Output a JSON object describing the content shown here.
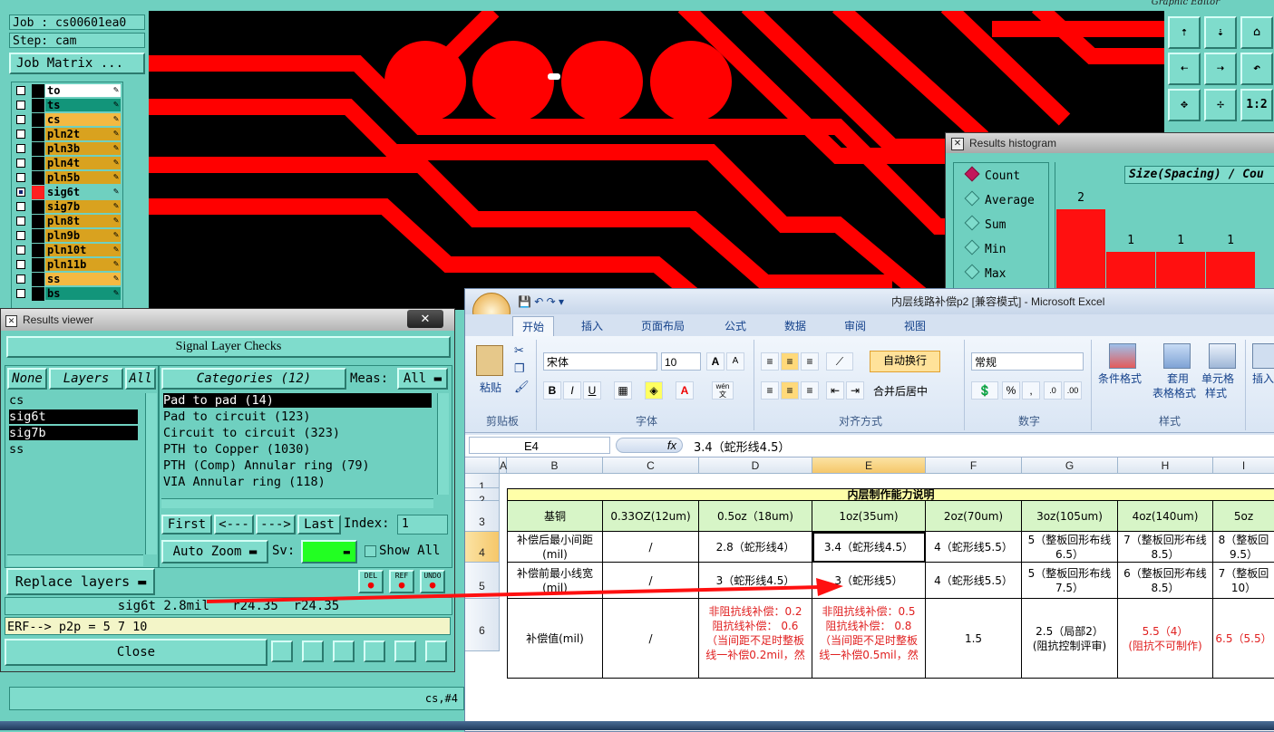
{
  "genesis": {
    "window_title": "Graphic Editor",
    "job_label": "Job : cs00601ea0",
    "step_label": "Step: cam",
    "job_matrix_button": "Job Matrix ...",
    "layers": [
      {
        "name": "to",
        "color": "#ffffff",
        "checked": false
      },
      {
        "name": "ts",
        "color": "#12957a",
        "checked": false
      },
      {
        "name": "cs",
        "color": "#f4b942",
        "checked": false
      },
      {
        "name": "pln2t",
        "color": "#d9a21f",
        "checked": false
      },
      {
        "name": "pln3b",
        "color": "#d9a21f",
        "checked": false
      },
      {
        "name": "pln4t",
        "color": "#d9a21f",
        "checked": false
      },
      {
        "name": "pln5b",
        "color": "#d9a21f",
        "checked": false
      },
      {
        "name": "sig6t",
        "color": "#6fd0c0",
        "checked": true
      },
      {
        "name": "sig7b",
        "color": "#d9a21f",
        "checked": false
      },
      {
        "name": "pln8t",
        "color": "#d9a21f",
        "checked": false
      },
      {
        "name": "pln9b",
        "color": "#d9a21f",
        "checked": false
      },
      {
        "name": "pln10t",
        "color": "#d9a21f",
        "checked": false
      },
      {
        "name": "pln11b",
        "color": "#d9a21f",
        "checked": false
      },
      {
        "name": "ss",
        "color": "#f4b942",
        "checked": false
      },
      {
        "name": "bs",
        "color": "#12957a",
        "checked": false
      }
    ],
    "toolbar": [
      "⇡",
      "⇣",
      "⌂",
      "⇠",
      "⇢",
      "↶",
      "✥",
      "✢",
      "1:2"
    ],
    "status_text": "cs,#4"
  },
  "histogram": {
    "title": "Results histogram",
    "options": [
      {
        "label": "Count",
        "selected": true
      },
      {
        "label": "Average",
        "selected": false
      },
      {
        "label": "Sum",
        "selected": false
      },
      {
        "label": "Min",
        "selected": false
      },
      {
        "label": "Max",
        "selected": false
      }
    ],
    "chart_header": "Size(Spacing) / Cou",
    "bars": [
      2,
      1,
      1,
      1
    ]
  },
  "results_viewer": {
    "title": "Results viewer",
    "close_x": "✕",
    "heading": "Signal Layer Checks",
    "none_btn": "None",
    "layers_btn": "Layers",
    "all_btn": "All",
    "layers": [
      "cs",
      "sig6t",
      "sig7b",
      "ss"
    ],
    "selected_layers": [
      "sig6t",
      "sig7b"
    ],
    "categories_btn": "Categories (12)",
    "meas_label": "Meas:",
    "meas_value": "All",
    "categories": [
      "Pad to pad (14)",
      "Pad to circuit (123)",
      "Circuit to circuit (323)",
      "PTH to Copper (1030)",
      "PTH (Comp) Annular ring (79)",
      "VIA Annular ring (118)"
    ],
    "nav": {
      "first": "First",
      "prev": "<---",
      "next": "--->",
      "last": "Last",
      "index_label": "Index:",
      "index_value": "1"
    },
    "auto_zoom": "Auto Zoom",
    "sv_label": "Sv:",
    "show_all": "Show All",
    "replace_layers": "Replace layers",
    "small_btns": [
      "DEL",
      "REF",
      "UNDO"
    ],
    "info_line": "sig6t 2.8mil   r24.35  r24.35",
    "erf_line": "ERF--> p2p = 5 7 10",
    "close_btn": "Close"
  },
  "excel": {
    "title": "内层线路补偿p2  [兼容模式] - Microsoft Excel",
    "tabs": [
      "开始",
      "插入",
      "页面布局",
      "公式",
      "数据",
      "审阅",
      "视图"
    ],
    "active_tab": "开始",
    "clipboard": {
      "paste": "粘贴",
      "group": "剪贴板"
    },
    "font": {
      "name": "宋体",
      "size": "10",
      "group": "字体",
      "bold": "B",
      "italic": "I",
      "underline": "U",
      "grow": "A",
      "shrink": "A",
      "wen": "wén",
      "wen2": "文"
    },
    "alignment": {
      "wrap": "自动换行",
      "merge": "合并后居中",
      "group": "对齐方式"
    },
    "number": {
      "format": "常规",
      "percent": "%",
      "comma": ",",
      "group": "数字"
    },
    "styles": {
      "cond": "条件格式",
      "table": "套用",
      "table2": "表格格式",
      "cell": "单元格",
      "cell2": "样式",
      "group": "样式"
    },
    "cells": {
      "insert": "插入"
    },
    "name_box": "E4",
    "fx": "fx",
    "formula": "3.4（蛇形线4.5）",
    "columns": [
      "A",
      "B",
      "C",
      "D",
      "E",
      "F",
      "G",
      "H",
      "I"
    ],
    "rows": [
      "1",
      "2",
      "3",
      "4",
      "5",
      "6"
    ],
    "table_title": "内层制作能力说明",
    "header_row": [
      "基铜",
      "0.33OZ(12um)",
      "0.5oz（18um)",
      "1oz(35um)",
      "2oz(70um)",
      "3oz(105um)",
      "4oz(140um)",
      "5oz"
    ],
    "row4": [
      "补偿后最小间距\n(mil)",
      "/",
      "2.8（蛇形线4）",
      "3.4（蛇形线4.5）",
      "4（蛇形线5.5）",
      "5（整板回形布线\n6.5）",
      "7（整板回形布线\n8.5）",
      "8（整板回\n9.5）"
    ],
    "row5": [
      "补偿前最小线宽\n(mil)",
      "/",
      "3（蛇形线4.5）",
      "3（蛇形线5）",
      "4（蛇形线5.5）",
      "5（整板回形布线\n7.5）",
      "6（整板回形布线\n8.5）",
      "7（整板回\n10）"
    ],
    "row6": {
      "label": "补偿值(mil)",
      "c": "/",
      "d1": "非阻抗线补偿：0.2",
      "d2": "阻抗线补偿： 0.6\n（当间距不足时整板\n线一补偿0.2mil，然",
      "e1": "非阻抗线补偿：0.5",
      "e2": "阻抗线补偿： 0.8\n（当间距不足时整板\n线一补偿0.5mil，然",
      "f": "1.5",
      "g": "2.5（局部2）\n(阻抗控制评审)",
      "h": "5.5（4）\n(阻抗不可制作)",
      "i": "6.5（5.5）"
    }
  }
}
